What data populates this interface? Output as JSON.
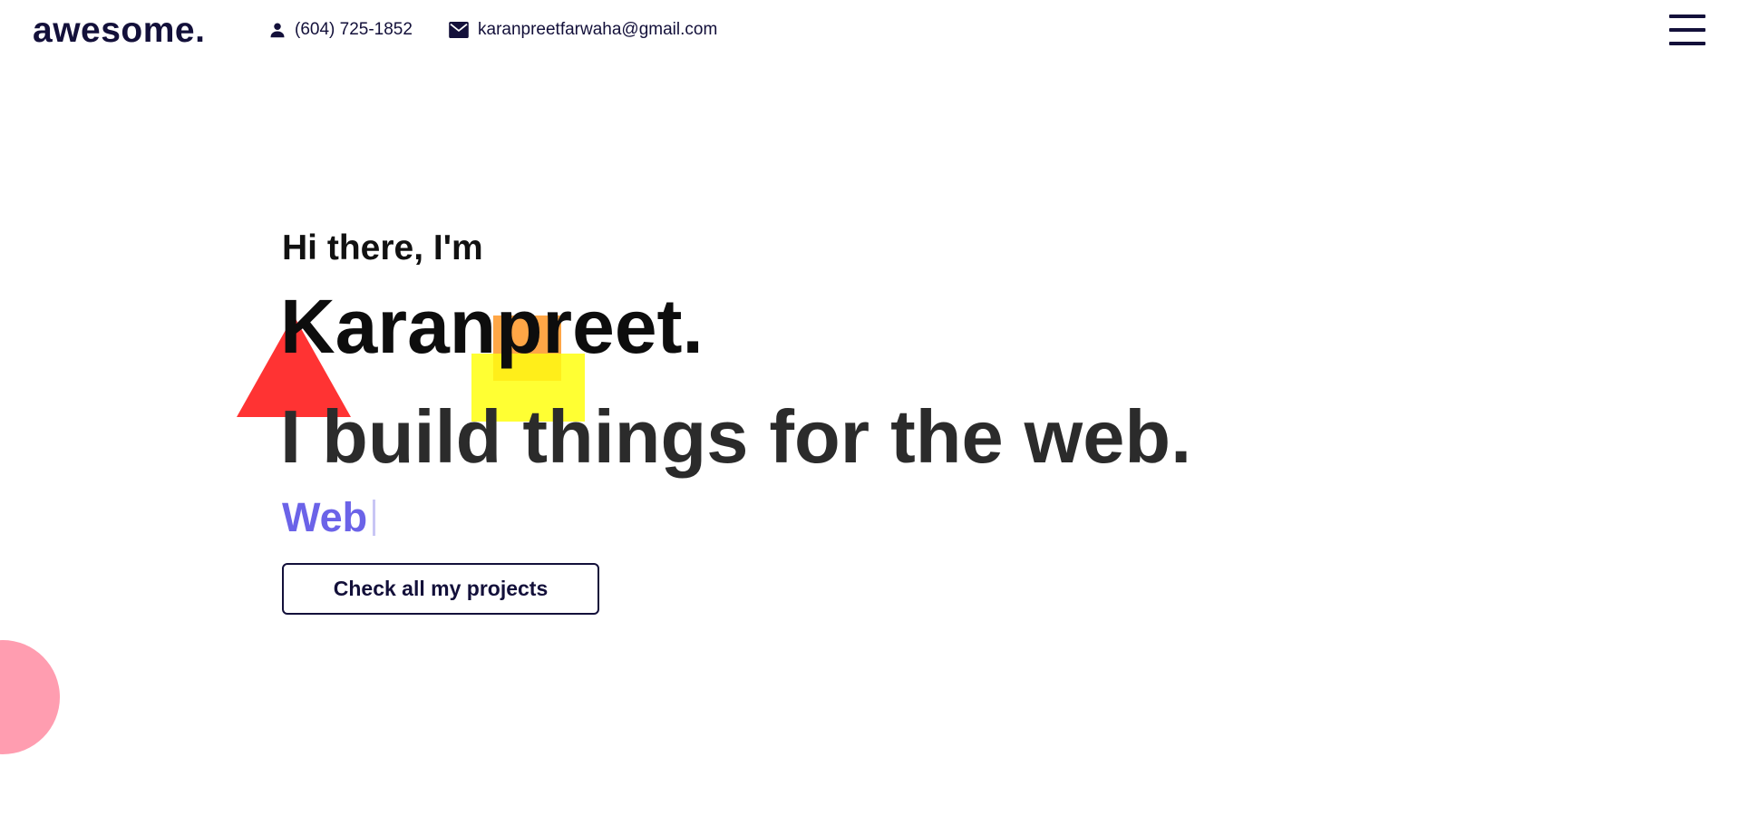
{
  "header": {
    "logo": "awesome.",
    "phone": "(604) 725-1852",
    "email": "karanpreetfarwaha@gmail.com",
    "phone_icon": "person-icon",
    "email_icon": "mail-icon",
    "menu_icon": "hamburger-menu-icon"
  },
  "hero": {
    "greeting": "Hi there, I'm",
    "name": "Karanpreet.",
    "tagline": "I build things for the web.",
    "typed_text": "Web",
    "cta_label": "Check all my projects"
  },
  "colors": {
    "brand": "#13103a",
    "accent": "#6b63e8",
    "triangle": "#ff3333",
    "orange": "#ffa646",
    "yellow": "#ffff33",
    "pink": "#ff9db0"
  }
}
